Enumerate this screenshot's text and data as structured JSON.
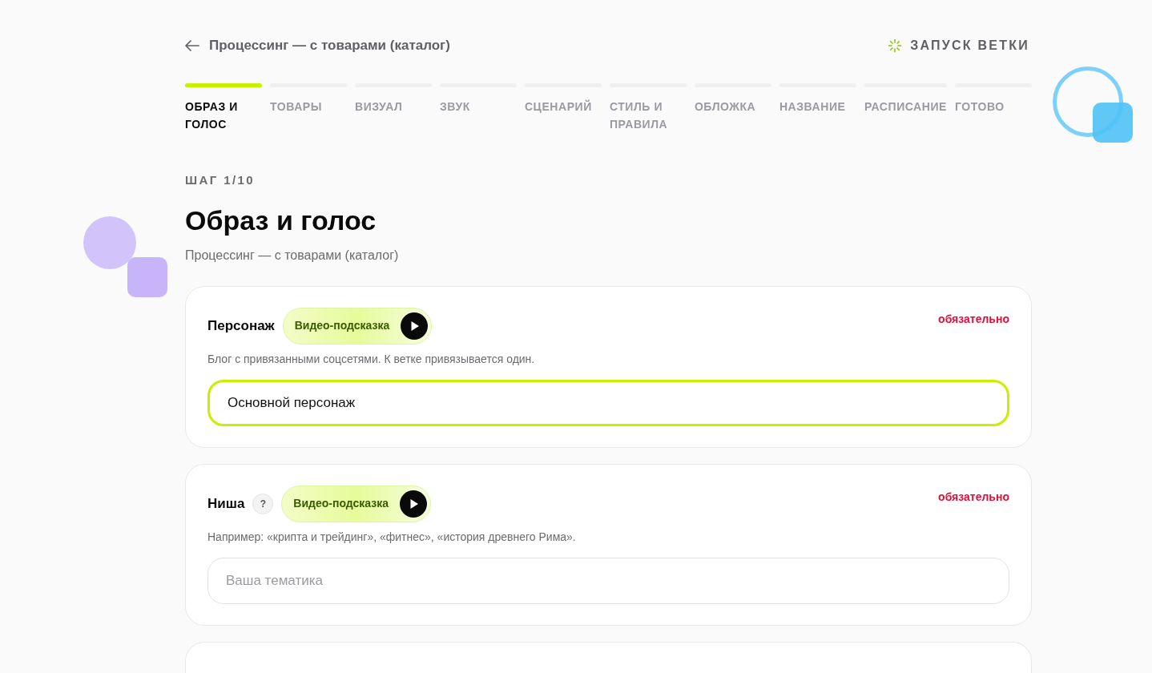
{
  "header": {
    "back_title": "Процессинг — с товарами (каталог)",
    "action": "ЗАПУСК ВЕТКИ"
  },
  "steps": [
    {
      "label": "ОБРАЗ И ГОЛОС",
      "selected": true
    },
    {
      "label": "ТОВАРЫ",
      "selected": false
    },
    {
      "label": "ВИЗУАЛ",
      "selected": false
    },
    {
      "label": "ЗВУК",
      "selected": false
    },
    {
      "label": "СЦЕНАРИЙ",
      "selected": false
    },
    {
      "label": "СТИЛЬ И ПРАВИЛА",
      "selected": false
    },
    {
      "label": "ОБЛОЖКА",
      "selected": false
    },
    {
      "label": "НАЗВАНИЕ",
      "selected": false
    },
    {
      "label": "РАСПИСАНИЕ",
      "selected": false
    },
    {
      "label": "ГОТОВО",
      "selected": false
    }
  ],
  "step_counter": "ШАГ 1/10",
  "title": "Образ и голос",
  "subtitle": "Процессинг — с товарами (каталог)",
  "fields": [
    {
      "label": "Персонаж",
      "help": false,
      "hint_button": "Видео-подсказка",
      "required": "обязательно",
      "description": "Блог с привязанными соцсетями. К ветке привязывается один.",
      "value": "Основной персонаж",
      "focused": true
    },
    {
      "label": "Ниша",
      "help": true,
      "help_mark": "?",
      "hint_button": "Видео-подсказка",
      "required": "обязательно",
      "description": "Например: «крипта и трейдинг», «фитнес», «история древнего Рима».",
      "placeholder": "Ваша тематика",
      "focused": false
    }
  ]
}
